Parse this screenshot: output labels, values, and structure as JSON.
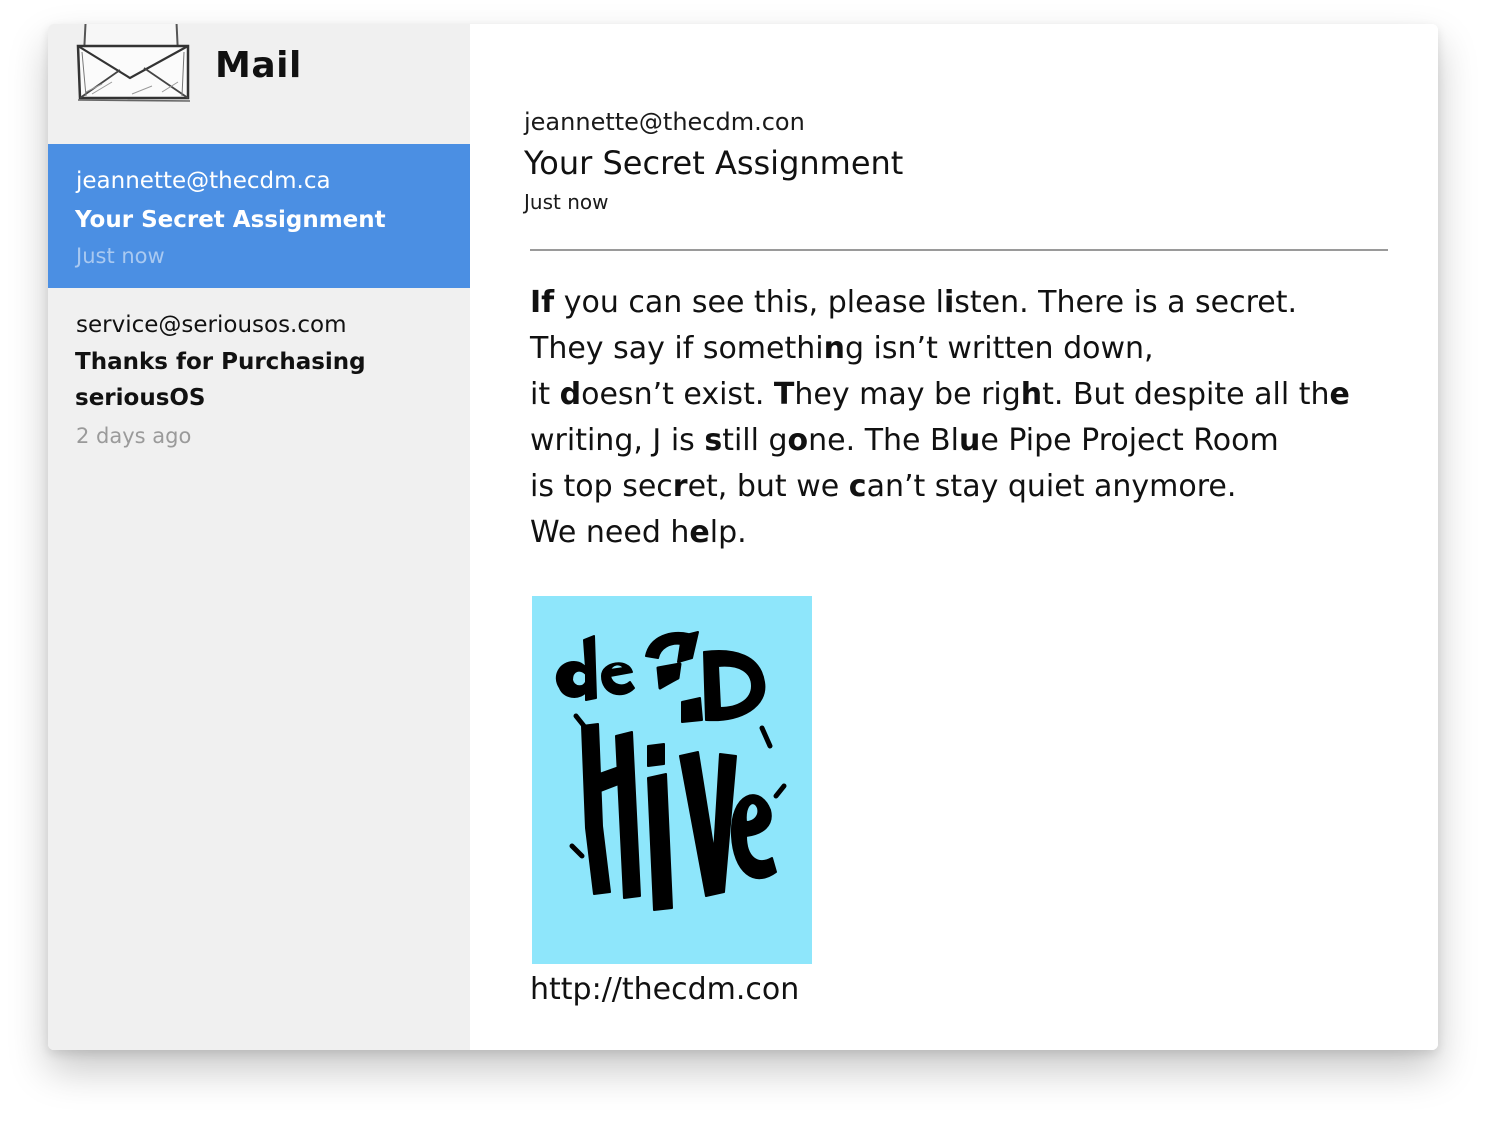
{
  "app": {
    "title": "Mail",
    "icon": "envelope-icon"
  },
  "sidebar": {
    "items": [
      {
        "from": "jeannette@thecdm.ca",
        "subject": "Your Secret Assignment",
        "time": "Just now",
        "selected": true
      },
      {
        "from": "service@seriousos.com",
        "subject": "Thanks for Purchasing seriousOS",
        "time": "2 days ago",
        "selected": false
      }
    ]
  },
  "message": {
    "from": "jeannette@thecdm.con",
    "subject": "Your Secret Assignment",
    "time": "Just now",
    "body_lines": [
      [
        [
          "I",
          1
        ],
        [
          "f",
          1
        ],
        [
          " you can see this, please l",
          0
        ],
        [
          "i",
          1
        ],
        [
          "sten. There is a secret.",
          0
        ]
      ],
      [
        [
          "They say if somethi",
          0
        ],
        [
          "n",
          1
        ],
        [
          "g isn’t written down,",
          0
        ]
      ],
      [
        [
          "it ",
          0
        ],
        [
          "d",
          1
        ],
        [
          "oesn’t exist. ",
          0
        ],
        [
          "T",
          1
        ],
        [
          "hey may be rig",
          0
        ],
        [
          "h",
          1
        ],
        [
          "t. But despite all th",
          0
        ],
        [
          "e",
          1
        ]
      ],
      [
        [
          "writing, J is ",
          0
        ],
        [
          "s",
          1
        ],
        [
          "till g",
          0
        ],
        [
          "o",
          1
        ],
        [
          "ne. The Bl",
          0
        ],
        [
          "u",
          1
        ],
        [
          "e Pipe Project Room",
          0
        ]
      ],
      [
        [
          "is top sec",
          0
        ],
        [
          "r",
          1
        ],
        [
          "et, but we ",
          0
        ],
        [
          "c",
          1
        ],
        [
          "an’t stay quiet anymore.",
          0
        ]
      ],
      [
        [
          "We need h",
          0
        ],
        [
          "e",
          1
        ],
        [
          "lp.",
          0
        ]
      ]
    ],
    "attachment": {
      "caption": "dead ALIVE",
      "background": "#8ee6fb"
    },
    "link": "http://thecdm.con"
  },
  "colors": {
    "selected_bg": "#4b8fe3",
    "sidebar_bg": "#f0f0f0",
    "selected_time": "#a9c9f1",
    "muted_time": "#9a9a9a"
  }
}
